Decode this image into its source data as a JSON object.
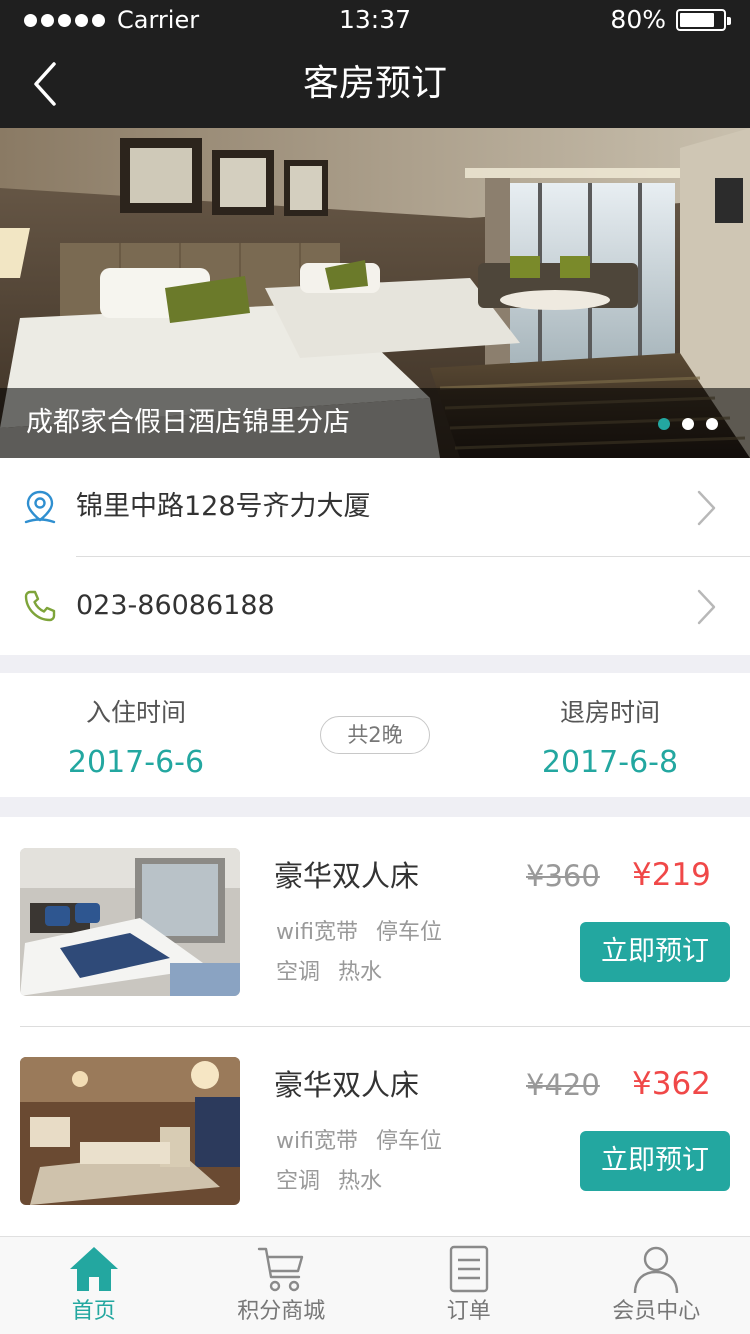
{
  "status_bar": {
    "carrier": "Carrier",
    "time": "13:37",
    "battery": "80%",
    "battery_level": 0.8
  },
  "nav": {
    "title": "客房预订",
    "back_icon": "chevron-left-icon"
  },
  "banner": {
    "hotel_name": "成都家合假日酒店锦里分店",
    "page_count": 3,
    "active_page": 1
  },
  "info": {
    "address": "锦里中路128号齐力大厦",
    "phone": "023-86086188",
    "address_icon": "location-pin-icon",
    "phone_icon": "phone-icon"
  },
  "stay": {
    "checkin_label": "入住时间",
    "checkin_date": "2017-6-6",
    "nights": "共2晚",
    "checkout_label": "退房时间",
    "checkout_date": "2017-6-8"
  },
  "rooms": [
    {
      "name": "豪华双人床",
      "original_price": "¥360",
      "price": "¥219",
      "tags": [
        "wifi宽带",
        "停车位",
        "空调",
        "热水"
      ],
      "button": "立即预订"
    },
    {
      "name": "豪华双人床",
      "original_price": "¥420",
      "price": "¥362",
      "tags": [
        "wifi宽带",
        "停车位",
        "空调",
        "热水"
      ],
      "button": "立即预订"
    }
  ],
  "tabbar": {
    "items": [
      {
        "label": "首页",
        "icon": "home-icon",
        "active": true
      },
      {
        "label": "积分商城",
        "icon": "cart-icon",
        "active": false
      },
      {
        "label": "订单",
        "icon": "document-icon",
        "active": false
      },
      {
        "label": "会员中心",
        "icon": "user-icon",
        "active": false
      }
    ]
  },
  "colors": {
    "accent": "#23a7a0",
    "price_red": "#f04848",
    "nav_bg": "#1f1f1f",
    "section_gap": "#efeff4"
  }
}
